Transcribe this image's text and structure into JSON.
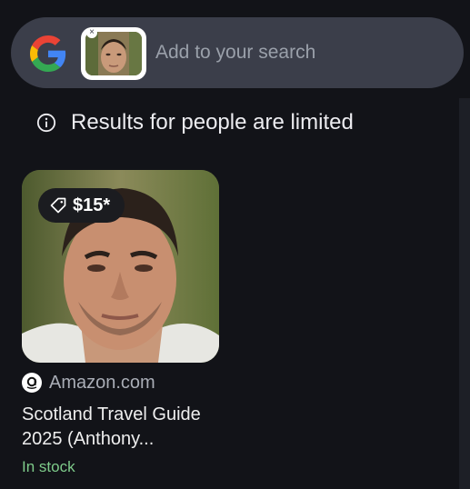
{
  "search": {
    "placeholder": "Add to your search",
    "logo_icon": "google-g-icon",
    "query_image_icon": "query-image-thumbnail",
    "remove_icon": "close-icon"
  },
  "notice": {
    "icon": "info-icon",
    "text": "Results for people are limited"
  },
  "results": [
    {
      "price": "$15*",
      "price_icon": "price-tag-icon",
      "merchant_icon": "amazon-icon",
      "merchant": "Amazon.com",
      "title": "Scotland Travel Guide 2025 (Anthony...",
      "stock": "In stock"
    }
  ],
  "colors": {
    "background": "#121318",
    "search_bar": "#3b3e4a",
    "stock_green": "#7ecb8a",
    "google_blue": "#4285F4",
    "google_red": "#EA4335",
    "google_yellow": "#FBBC05",
    "google_green": "#34A853"
  }
}
